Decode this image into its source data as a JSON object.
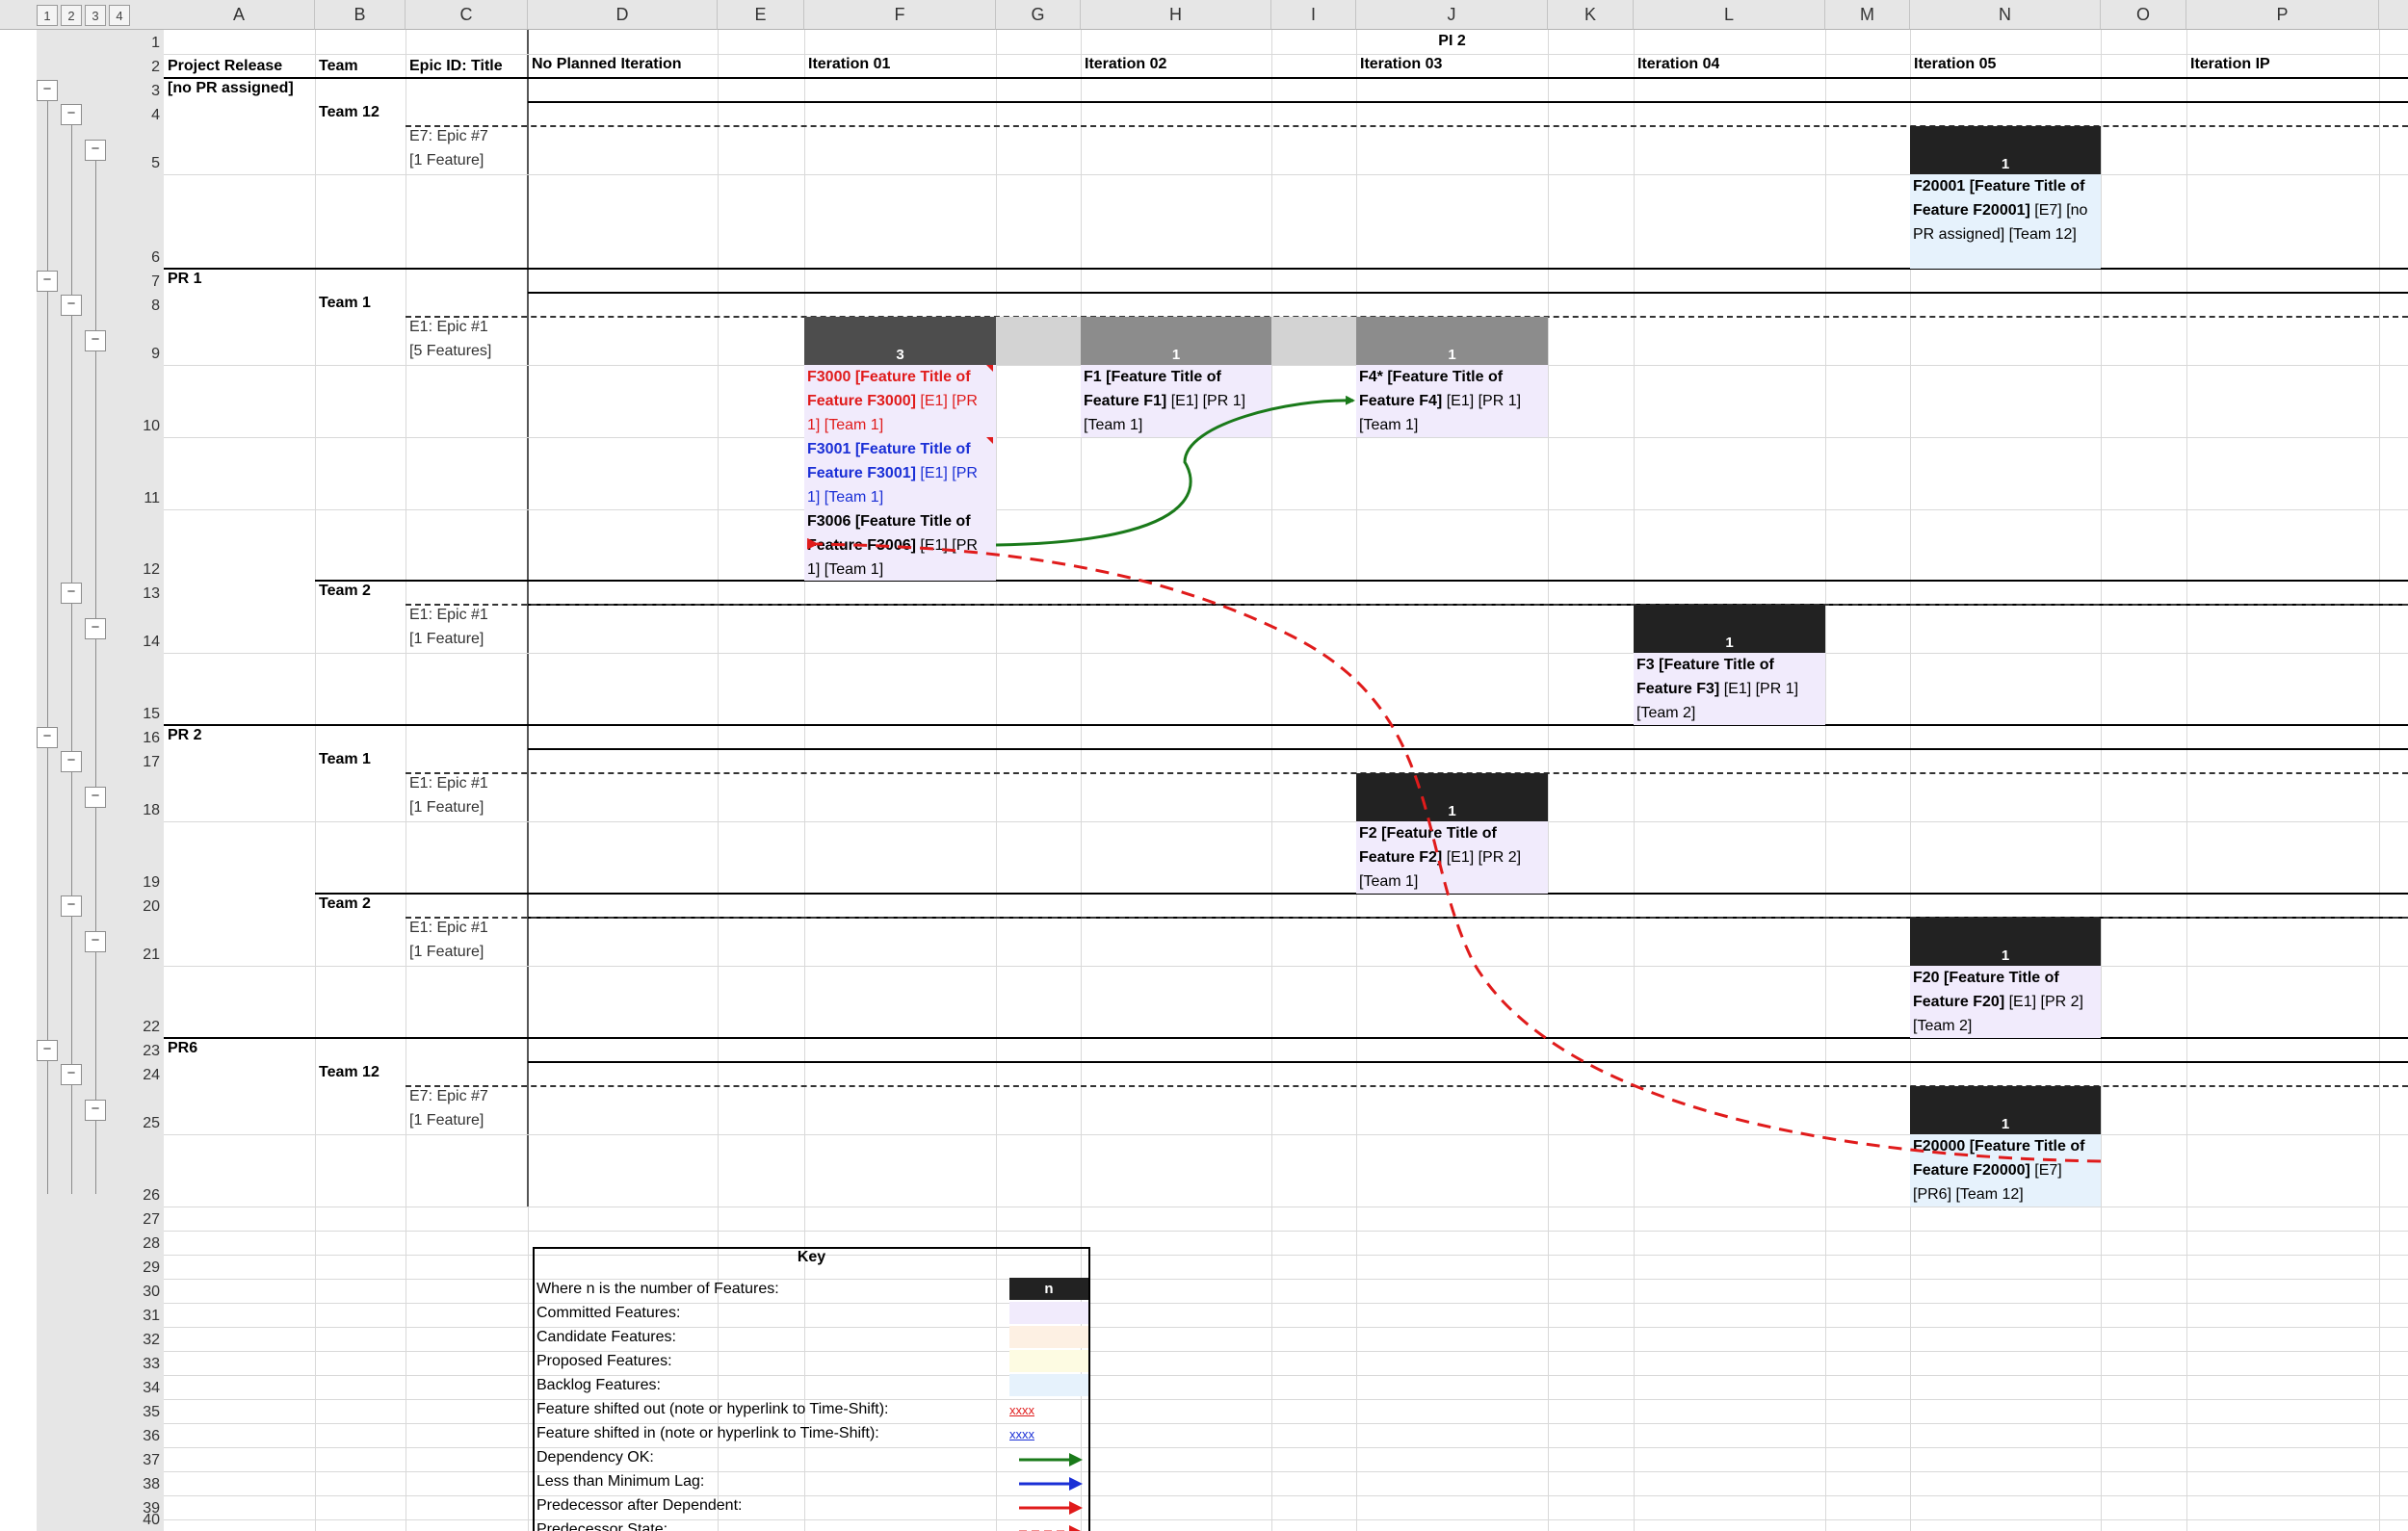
{
  "outline_levels": [
    "1",
    "2",
    "3",
    "4"
  ],
  "columns": [
    "A",
    "B",
    "C",
    "D",
    "E",
    "F",
    "G",
    "H",
    "I",
    "J",
    "K",
    "L",
    "M",
    "N",
    "O",
    "P"
  ],
  "rows": [
    "1",
    "2",
    "3",
    "4",
    "5",
    "6",
    "7",
    "8",
    "9",
    "10",
    "11",
    "12",
    "13",
    "14",
    "15",
    "16",
    "17",
    "18",
    "19",
    "20",
    "21",
    "22",
    "23",
    "24",
    "25",
    "26",
    "27",
    "28",
    "29",
    "30",
    "31",
    "32",
    "33",
    "34",
    "35",
    "36",
    "37",
    "38",
    "39",
    "40"
  ],
  "toggle_symbol": "−",
  "header": {
    "pi": "PI 2",
    "project_release": "Project Release",
    "team": "Team",
    "epic": "Epic ID: Title",
    "no_planned": "No Planned Iteration",
    "iter01": "Iteration 01",
    "iter02": "Iteration 02",
    "iter03": "Iteration 03",
    "iter04": "Iteration 04",
    "iter05": "Iteration 05",
    "iterIP": "Iteration IP"
  },
  "groups": {
    "no_pr": "[no PR assigned]",
    "pr1": "PR 1",
    "pr2": "PR 2",
    "pr6": "PR6",
    "team12": "Team 12",
    "team1": "Team 1",
    "team2": "Team 2",
    "e7_l1": "E7: Epic #7",
    "e1_l1": "E1: Epic #1",
    "one_feature": "[1 Feature]",
    "five_features": "[5 Features]"
  },
  "cards": {
    "c3": "3",
    "c1": "1",
    "f20001_b": "F20001 [Feature Title of Feature F20001]",
    "f20001_n": " [E7] [no PR assigned] [Team 12]",
    "f3000_b": "F3000 [Feature Title of Feature F3000]",
    "f3000_n": " [E1] [PR 1] [Team 1]",
    "f3001_b": "F3001 [Feature Title of Feature F3001]",
    "f3001_n": " [E1] [PR 1] [Team 1]",
    "f3006_b": "F3006 [Feature Title of Feature F3006]",
    "f3006_n": " [E1] [PR 1] [Team 1]",
    "f1_b": "F1 [Feature Title of Feature F1]",
    "f1_n": " [E1] [PR 1] [Team 1]",
    "f4_b": "F4* [Feature Title of Feature F4]",
    "f4_n": " [E1] [PR 1] [Team 1]",
    "f3_b": "F3 [Feature Title of Feature F3]",
    "f3_n": " [E1] [PR 1] [Team 2]",
    "f2_b": "F2 [Feature Title of Feature F2]",
    "f2_n": " [E1] [PR 2] [Team 1]",
    "f20_b": "F20 [Feature Title of Feature F20]",
    "f20_n": " [E1] [PR 2] [Team 2]",
    "f20000_b": "F20000 [Feature Title of Feature F20000]",
    "f20000_n": " [E7] [PR6] [Team 12]"
  },
  "key": {
    "title": "Key",
    "n_label": "Where n is the number of Features:",
    "n": "n",
    "committed": "Committed Features:",
    "candidate": "Candidate Features:",
    "proposed": "Proposed Features:",
    "backlog": "Backlog Features:",
    "shifted_out": "Feature shifted out (note or hyperlink to Time-Shift):",
    "shifted_in": "Feature shifted in (note or hyperlink to Time-Shift):",
    "xxxx": "xxxx",
    "dep_ok": "Dependency OK:",
    "min_lag": "Less than Minimum Lag:",
    "pred_after": "Predecessor after Dependent:",
    "pred_state": "Predecessor State:"
  },
  "colors": {
    "committed": "#f1ebfc",
    "candidate": "#fdf0e3",
    "proposed": "#fdfbe2",
    "backlog": "#e6f2fc",
    "dep_ok": "#1a7a1a",
    "min_lag": "#1a2fd6",
    "pred_red": "#e01b1b",
    "shifted_out": "#e01b1b",
    "shifted_in": "#1a2fd6"
  }
}
